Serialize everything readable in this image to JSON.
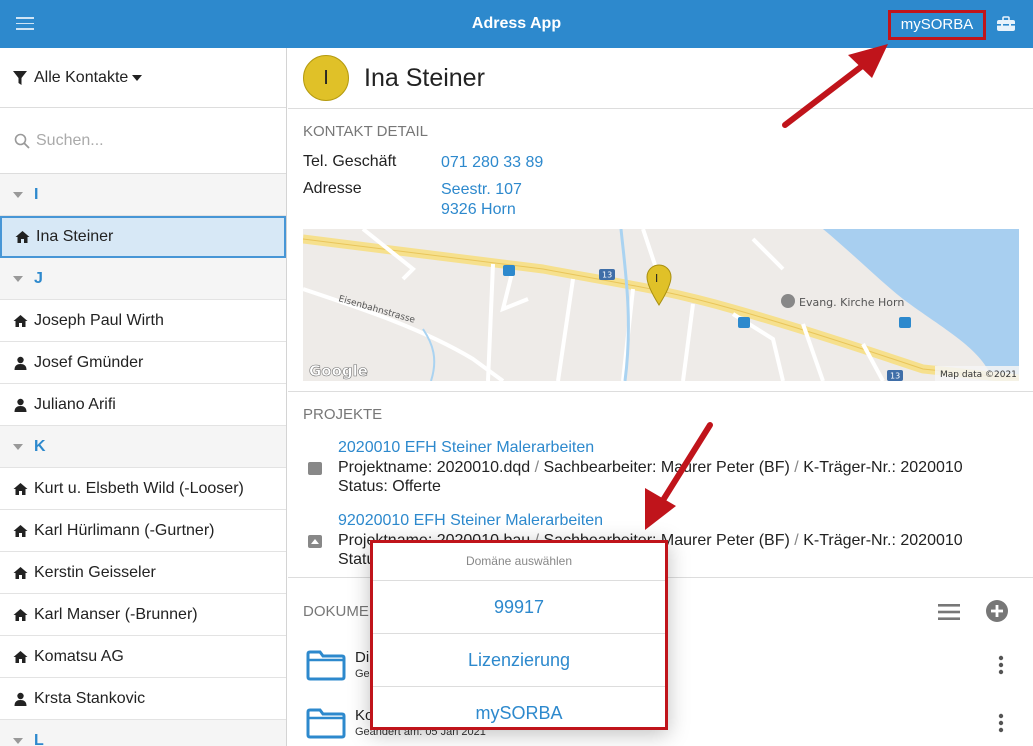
{
  "header": {
    "title": "Adress App",
    "domain_button": "mySORBA"
  },
  "sidebar": {
    "filter_label": "Alle Kontakte",
    "search_placeholder": "Suchen...",
    "items": [
      {
        "type": "group",
        "label": "I"
      },
      {
        "type": "company",
        "label": "Ina Steiner",
        "selected": true
      },
      {
        "type": "group",
        "label": "J"
      },
      {
        "type": "company",
        "label": "Joseph Paul Wirth"
      },
      {
        "type": "person",
        "label": "Josef Gmünder"
      },
      {
        "type": "person",
        "label": "Juliano Arifi"
      },
      {
        "type": "group",
        "label": "K"
      },
      {
        "type": "company",
        "label": "Kurt u. Elsbeth Wild (-Looser)"
      },
      {
        "type": "company",
        "label": "Karl Hürlimann (-Gurtner)"
      },
      {
        "type": "company",
        "label": "Kerstin Geisseler"
      },
      {
        "type": "company",
        "label": "Karl Manser (-Brunner)"
      },
      {
        "type": "company",
        "label": "Komatsu AG"
      },
      {
        "type": "person",
        "label": "Krsta Stankovic"
      },
      {
        "type": "group",
        "label": "L"
      }
    ]
  },
  "contact": {
    "initial": "I",
    "name": "Ina Steiner",
    "detail_title": "KONTAKT DETAIL",
    "phone_label": "Tel. Geschäft",
    "phone_value": "071 280 33 89",
    "address_label": "Adresse",
    "address_line1": "Seestr. 107",
    "address_line2": "9326 Horn"
  },
  "map": {
    "road_number": "13",
    "street_label": "Eisenbahnstrasse",
    "poi_label": "Evang. Kirche Horn",
    "pin_letter": "I",
    "attribution": "Map data ©2021",
    "logo": "Google"
  },
  "projects": {
    "title": "PROJEKTE",
    "items": [
      {
        "title": "2020010 EFH Steiner Malerarbeiten",
        "line1_parts": [
          "Projektname: 2020010.dqd",
          "Sachbearbeiter: Maurer Peter (BF)",
          "K-Träger-Nr.: 2020010"
        ],
        "status": "Status: Offerte"
      },
      {
        "title": "92020010 EFH Steiner Malerarbeiten",
        "line1_parts": [
          "Projektname: 2020010.bau",
          "Sachbearbeiter: Maurer Peter (BF)",
          "K-Träger-Nr.: 2020010"
        ],
        "status": "Status"
      }
    ]
  },
  "documents": {
    "title": "DOKUME",
    "items": [
      {
        "name": "Di",
        "sub": "Ge"
      },
      {
        "name": "Ko",
        "sub": "Geändert am: 05 Jan 2021"
      }
    ]
  },
  "popover": {
    "title": "Domäne auswählen",
    "options": [
      "99917",
      "Lizenzierung",
      "mySORBA"
    ]
  },
  "colors": {
    "primary": "#2d89cd",
    "annotation": "#c0141b",
    "avatar": "#e0c128"
  }
}
